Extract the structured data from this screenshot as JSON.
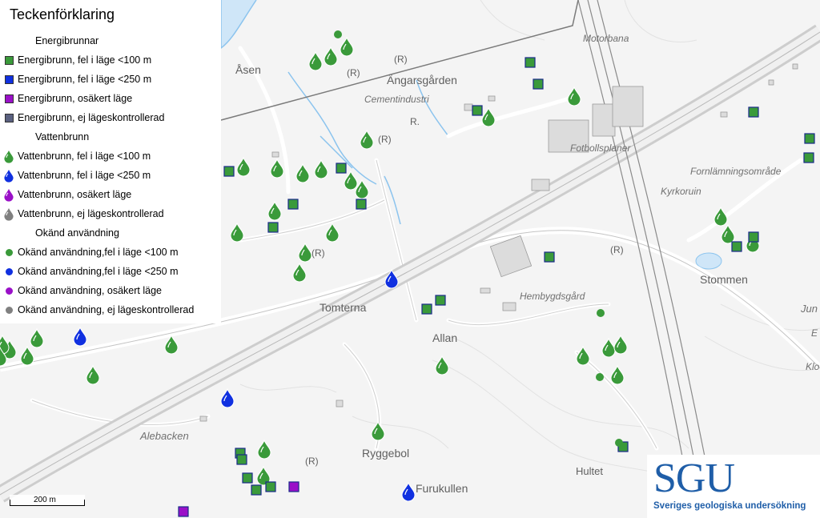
{
  "legend": {
    "title": "Teckenförklaring",
    "groups": {
      "energi": "Energibrunnar",
      "vatten": "Vattenbrunn",
      "okand": "Okänd användning"
    },
    "items": [
      {
        "label": "Energibrunn, fel i läge <100 m",
        "color": "#3a9a3a",
        "shape": "square"
      },
      {
        "label": "Energibrunn, fel i läge <250 m",
        "color": "#1030e0",
        "shape": "square"
      },
      {
        "label": "Energibrunn, osäkert läge",
        "color": "#9a10c8",
        "shape": "square"
      },
      {
        "label": "Energibrunn, ej lägeskontrollerad",
        "color": "#5a6080",
        "shape": "square"
      },
      {
        "label": "Vattenbrunn, fel i läge <100 m",
        "color": "#3a9a3a",
        "shape": "drop"
      },
      {
        "label": "Vattenbrunn, fel i läge <250 m",
        "color": "#1030e0",
        "shape": "drop"
      },
      {
        "label": "Vattenbrunn, osäkert läge",
        "color": "#9a10c8",
        "shape": "drop"
      },
      {
        "label": "Vattenbrunn, ej lägeskontrollerad",
        "color": "#808080",
        "shape": "drop"
      },
      {
        "label": "Okänd användning,fel i läge <100 m",
        "color": "#3a9a3a",
        "shape": "dot"
      },
      {
        "label": "Okänd användning,fel i läge <250 m",
        "color": "#1030e0",
        "shape": "dot"
      },
      {
        "label": "Okänd användning, osäkert läge",
        "color": "#9a10c8",
        "shape": "dot"
      },
      {
        "label": "Okänd användning, ej lägeskontrollerad",
        "color": "#808080",
        "shape": "dot"
      }
    ]
  },
  "places": {
    "asen": "Åsen",
    "angarsgarden": "Ängarsgården",
    "cementindustri": "Cementindustri",
    "motorbana": "Motorbana",
    "fotbollsplaner": "Fotbollsplaner",
    "fornlamning": "Fornlämningsområde",
    "kyrkoruin": "Kyrkoruin",
    "stommen": "Stommen",
    "tomterna": "Tomterna",
    "hembygdsgard": "Hembygdsgård",
    "allan": "Allan",
    "alebacken": "Alebacken",
    "ryggebol": "Ryggebol",
    "furukullen": "Furukullen",
    "hultet": "Hultet",
    "jun": "Jun",
    "e": "E",
    "klo": "Klo",
    "r": "(R)",
    "r_plain": "R."
  },
  "scale": {
    "label": "200 m"
  },
  "logo": {
    "mark": "SGU",
    "subtitle": "Sveriges geologiska undersökning"
  },
  "colors": {
    "green": "#3a9a3a",
    "blue": "#1030e0",
    "purple": "#9a10c8",
    "road": "#c8c8c8",
    "water": "#7ab4e8"
  }
}
